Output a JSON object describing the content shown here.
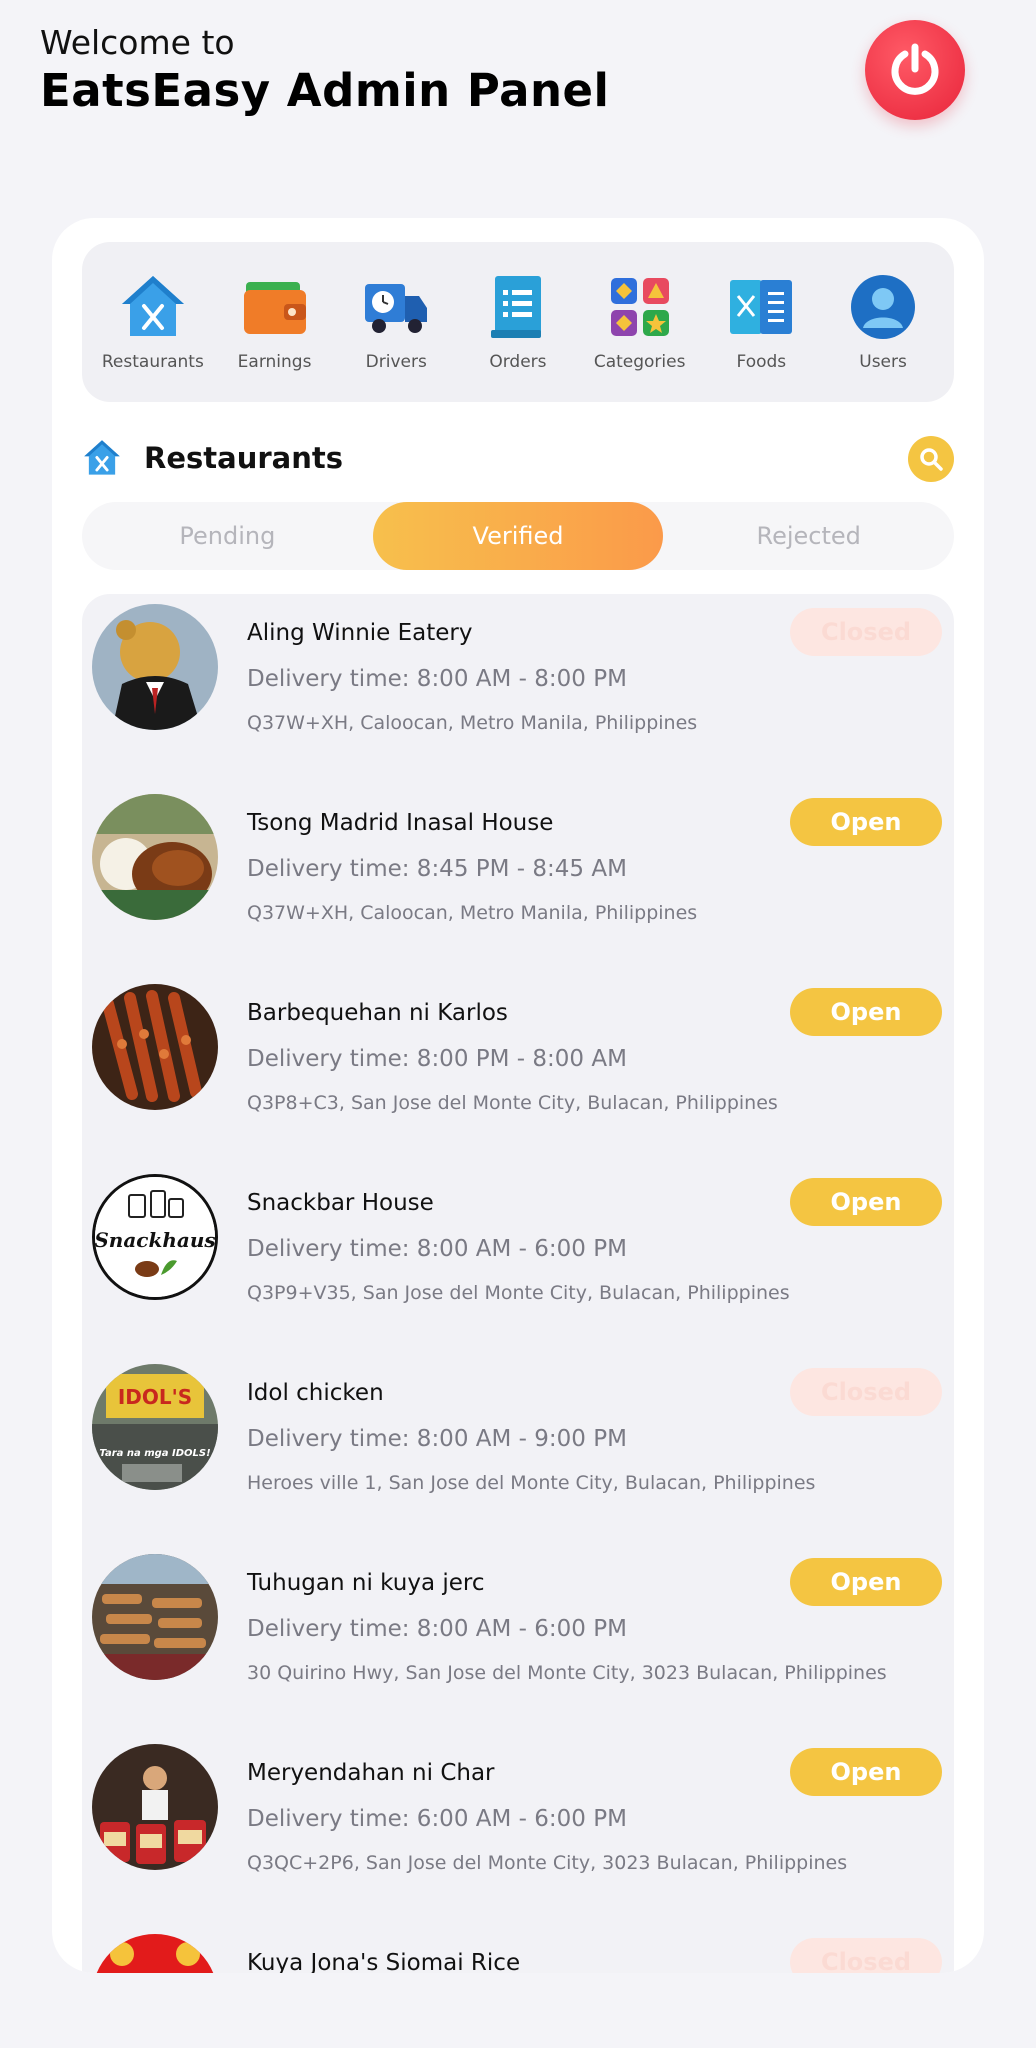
{
  "header": {
    "welcome": "Welcome to",
    "title": "EatsEasy Admin Panel",
    "power_icon": "power-icon"
  },
  "nav": [
    {
      "label": "Restaurants",
      "icon": "restaurant-icon"
    },
    {
      "label": "Earnings",
      "icon": "wallet-icon"
    },
    {
      "label": "Drivers",
      "icon": "truck-icon"
    },
    {
      "label": "Orders",
      "icon": "orders-list-icon"
    },
    {
      "label": "Categories",
      "icon": "categories-icon"
    },
    {
      "label": "Foods",
      "icon": "foods-icon"
    },
    {
      "label": "Users",
      "icon": "user-icon"
    }
  ],
  "section": {
    "title": "Restaurants",
    "icon": "restaurant-icon",
    "search_icon": "search-icon"
  },
  "tabs": [
    {
      "label": "Pending"
    },
    {
      "label": "Verified",
      "active": true
    },
    {
      "label": "Rejected"
    }
  ],
  "restaurants": [
    {
      "name": "Aling Winnie Eatery",
      "delivery": "Delivery time: 8:00 AM - 8:00 PM",
      "address": "Q37W+XH, Caloocan, Metro Manila, Philippines",
      "status": "Closed"
    },
    {
      "name": "Tsong Madrid Inasal House",
      "delivery": "Delivery time: 8:45 PM - 8:45 AM",
      "address": "Q37W+XH, Caloocan, Metro Manila, Philippines",
      "status": "Open"
    },
    {
      "name": "Barbequehan ni Karlos",
      "delivery": "Delivery time: 8:00 PM - 8:00 AM",
      "address": "Q3P8+C3, San Jose del Monte City, Bulacan, Philippines",
      "status": "Open"
    },
    {
      "name": "Snackbar House",
      "delivery": "Delivery time: 8:00 AM - 6:00 PM",
      "address": "Q3P9+V35, San Jose del Monte City, Bulacan, Philippines",
      "status": "Open"
    },
    {
      "name": "Idol chicken",
      "delivery": "Delivery time: 8:00 AM - 9:00 PM",
      "address": "Heroes ville 1, San Jose del Monte City, Bulacan, Philippines",
      "status": "Closed"
    },
    {
      "name": "Tuhugan ni kuya jerc",
      "delivery": "Delivery time: 8:00 AM - 6:00 PM",
      "address": "30 Quirino Hwy, San Jose del Monte City, 3023 Bulacan, Philippines",
      "status": "Open"
    },
    {
      "name": "Meryendahan ni Char",
      "delivery": "Delivery time: 6:00 AM - 6:00 PM",
      "address": "Q3QC+2P6, San Jose del Monte City, 3023 Bulacan, Philippines",
      "status": "Open"
    },
    {
      "name": "Kuya Jona's Siomai Rice",
      "delivery": "",
      "address": "",
      "status": "Closed"
    }
  ],
  "thumb_logo_text": "Snackhaus",
  "idol_sign_text": "IDOL'S",
  "idol_caption": "Tara na mga IDOLS!"
}
